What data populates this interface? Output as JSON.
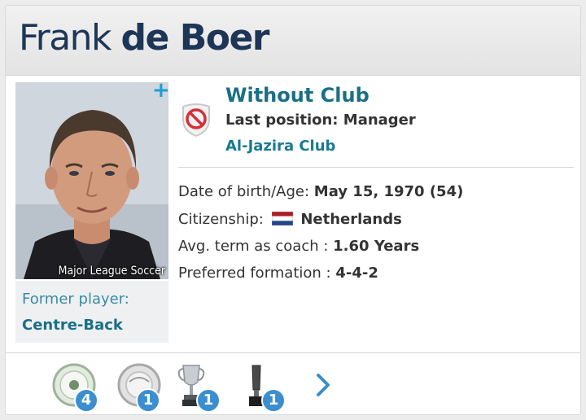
{
  "player": {
    "first_name": "Frank",
    "last_name": "de Boer",
    "photo_caption": "Major League Soccer"
  },
  "former": {
    "label": "Former player:",
    "position": "Centre-Back"
  },
  "club": {
    "status": "Without Club",
    "last_position_label": "Last position:",
    "last_position_value": "Manager",
    "name": "Al-Jazira Club",
    "crest_icon": "no-club-icon"
  },
  "info": {
    "dob_label": "Date of birth/Age:",
    "dob_value": "May 15, 1970 (54)",
    "citizenship_label": "Citizenship:",
    "citizenship_value": "Netherlands",
    "avg_term_label": "Avg. term as coach :",
    "avg_term_value": "1.60 Years",
    "formation_label": "Preferred formation :",
    "formation_value": "4-4-2"
  },
  "trophies": [
    {
      "icon": "eredivisie-plate-icon",
      "count": "4"
    },
    {
      "icon": "silver-plate-icon",
      "count": "1"
    },
    {
      "icon": "silver-cup-icon",
      "count": "1"
    },
    {
      "icon": "dark-trophy-icon",
      "count": "1"
    }
  ],
  "colors": {
    "accent": "#1a6f86",
    "badge": "#3b8ed0",
    "name": "#1d3557"
  }
}
